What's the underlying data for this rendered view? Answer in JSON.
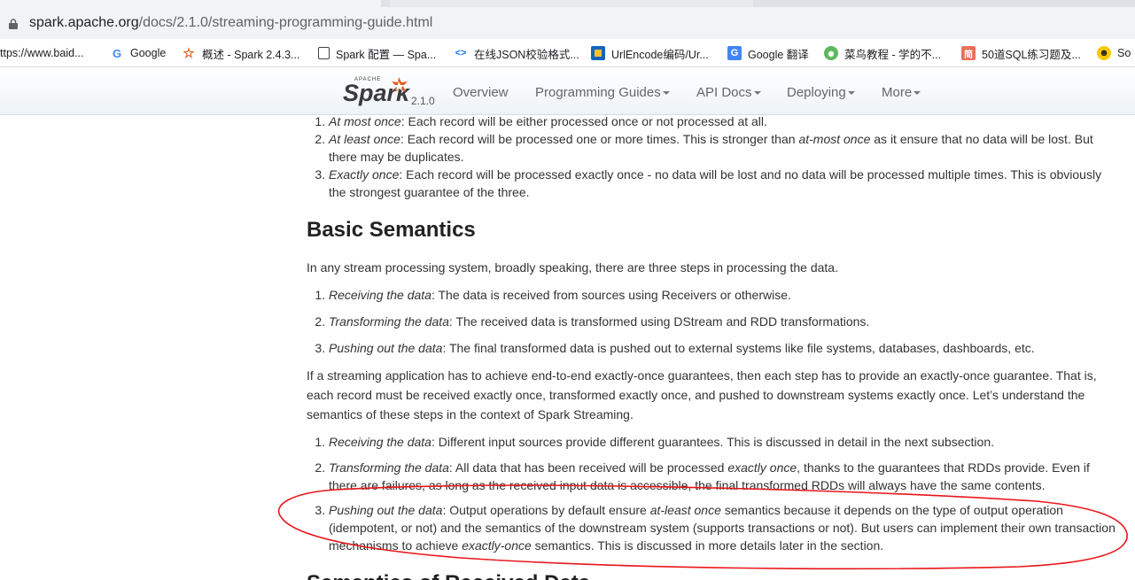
{
  "browser": {
    "url_host": "spark.apache.org",
    "url_path": "/docs/2.1.0/streaming-programming-guide.html",
    "bookmarks": [
      {
        "label": "ttps://www.baid...",
        "icon": "none"
      },
      {
        "label": "Google",
        "icon": "google-icon"
      },
      {
        "label": "概述 - Spark 2.4.3...",
        "icon": "spark-icon"
      },
      {
        "label": "Spark 配置 — Spa...",
        "icon": "page-icon"
      },
      {
        "label": "在线JSON校验格式...",
        "icon": "json-icon"
      },
      {
        "label": "UrlEncode编码/Ur...",
        "icon": "urlencode-icon"
      },
      {
        "label": "Google 翻译",
        "icon": "translate-icon"
      },
      {
        "label": "菜鸟教程 - 学的不...",
        "icon": "runoob-icon"
      },
      {
        "label": "50道SQL练习题及...",
        "icon": "jianshu-icon"
      },
      {
        "label": "So",
        "icon": "smiley-icon"
      }
    ]
  },
  "site": {
    "logo_version": "2.1.0",
    "nav": [
      {
        "label": "Overview",
        "dropdown": false
      },
      {
        "label": "Programming Guides",
        "dropdown": true
      },
      {
        "label": "API Docs",
        "dropdown": true
      },
      {
        "label": "Deploying",
        "dropdown": true
      },
      {
        "label": "More",
        "dropdown": true
      }
    ]
  },
  "top_list": [
    {
      "term": "At most once",
      "text": ": Each record will be either processed once or not processed at all."
    },
    {
      "term": "At least once",
      "text": ": Each record will be processed one or more times. This is stronger than ",
      "em2": "at-most once",
      "text2": " as it ensure that no data will be lost. But there may be duplicates."
    },
    {
      "term": "Exactly once",
      "text": ": Each record will be processed exactly once - no data will be lost and no data will be processed multiple times. This is obviously the strongest guarantee of the three."
    }
  ],
  "heading": "Basic Semantics",
  "intro": "In any stream processing system, broadly speaking, there are three steps in processing the data.",
  "steps": [
    {
      "term": "Receiving the data",
      "text": ": The data is received from sources using Receivers or otherwise."
    },
    {
      "term": "Transforming the data",
      "text": ": The received data is transformed using DStream and RDD transformations."
    },
    {
      "term": "Pushing out the data",
      "text": ": The final transformed data is pushed out to external systems like file systems, databases, dashboards, etc."
    }
  ],
  "paragraph": "If a streaming application has to achieve end-to-end exactly-once guarantees, then each step has to provide an exactly-once guarantee. That is, each record must be received exactly once, transformed exactly once, and pushed to downstream systems exactly once. Let’s understand the semantics of these steps in the context of Spark Streaming.",
  "guarantees": [
    {
      "term": "Receiving the data",
      "text": ": Different input sources provide different guarantees. This is discussed in detail in the next subsection."
    },
    {
      "term": "Transforming the data",
      "text": ": All data that has been received will be processed ",
      "em2": "exactly once",
      "text2": ", thanks to the guarantees that RDDs provide. Even if there are failures, as long as the received input data is accessible, the final transformed RDDs will always have the same contents."
    },
    {
      "term": "Pushing out the data",
      "text": ": Output operations by default ensure ",
      "em2": "at-least once",
      "text2": " semantics because it depends on the type of output operation (idempotent, or not) and the semantics of the downstream system (supports transactions or not). But users can implement their own transaction mechanisms to achieve ",
      "em3": "exactly-once",
      "text3": " semantics. This is discussed in more details later in the section."
    }
  ],
  "next_heading_partial": "Semantics of Received Data",
  "colors": {
    "annotation": "#e8161b",
    "spark_orange": "#e25a1c",
    "spark_grey": "#3c3a3e"
  }
}
